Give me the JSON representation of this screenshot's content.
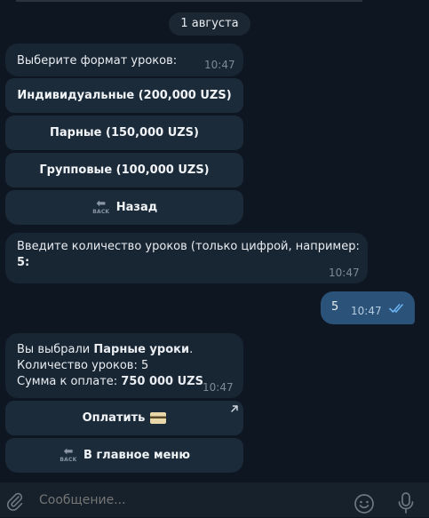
{
  "date_separator": "1 августа",
  "messages": {
    "format_prompt": {
      "text": "Выберите формат уроков:",
      "time": "10:47"
    },
    "format_buttons": {
      "individual": "Индивидуальные (200,000 UZS)",
      "pair": "Парные (150,000 UZS)",
      "group": "Групповые (100,000 UZS)",
      "back": "Назад",
      "back_icon_caption": "BACK"
    },
    "count_prompt": {
      "line1": "Введите количество уроков (только цифрой, например:",
      "example": "5",
      "suffix": ":",
      "time": "10:47"
    },
    "user_reply": {
      "text": "5",
      "time": "10:47",
      "status": "read"
    },
    "summary": {
      "line1_prefix": "Вы выбрали ",
      "line1_bold": "Парные уроки",
      "line1_suffix": ".",
      "line2": "Количество уроков: 5",
      "line3_prefix": "Сумма к оплате: ",
      "line3_bold": "750 000 UZS",
      "time": "10:47"
    },
    "summary_buttons": {
      "pay": "Оплатить",
      "main_menu": "В главное меню",
      "back_icon_caption": "BACK"
    }
  },
  "composer": {
    "placeholder": "Сообщение..."
  },
  "icons": {
    "attach": "paperclip-icon",
    "emoji": "smile-icon",
    "voice": "microphone-icon",
    "read_ticks": "double-check-icon",
    "payment": "credit-card-icon",
    "external": "arrow-up-right-icon",
    "back": "back-arrow-icon"
  },
  "colors": {
    "background": "#0e1621",
    "incoming_bubble": "#182533",
    "outgoing_bubble": "#2b5278",
    "inline_button": "#1c2b3a",
    "read_ticks": "#6ab3f3"
  }
}
